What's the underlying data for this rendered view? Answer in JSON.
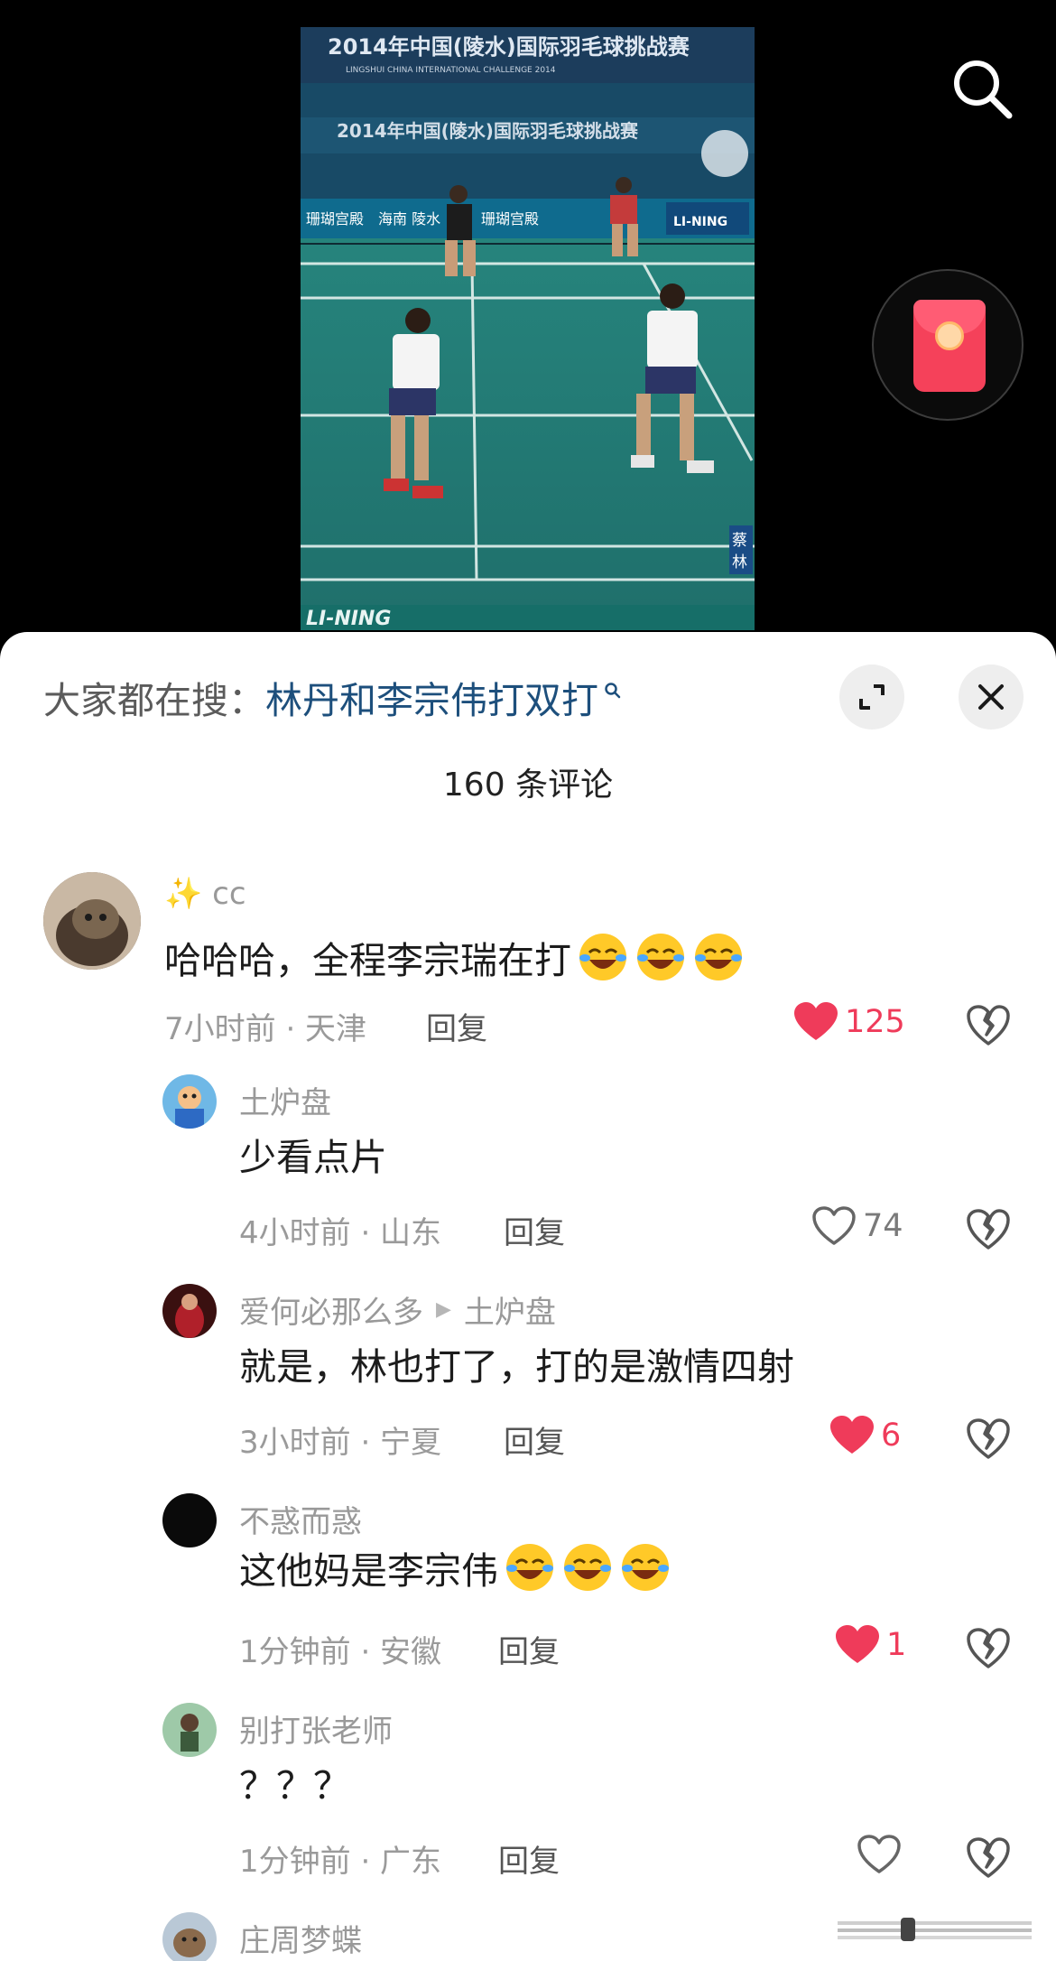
{
  "video": {
    "banner_title": "2014年中国(陵水)国际羽毛球挑战赛",
    "banner_subtitle": "LINGSHUI CHINA INTERNATIONAL CHALLENGE 2014",
    "sponsor": "LI-NING",
    "sponsor_board_1": "海南 陵水",
    "sponsor_board_2": "珊瑚宫殿",
    "scoreboard_1": "蔡",
    "scoreboard_2": "林"
  },
  "hot_search": {
    "prefix": "大家都在搜：",
    "query": "林丹和李宗伟打双打"
  },
  "comment_count": "160 条评论",
  "colors": {
    "like_red": "#ef3b5a",
    "link_blue": "#1d4f7c",
    "meta_gray": "#9a9a9a"
  },
  "comments": [
    {
      "user": "✨ cc",
      "text": "哈哈哈，全程李宗瑞在打",
      "emoji": [
        "laughing-crying-emoji",
        "laughing-crying-emoji",
        "laughing-crying-emoji"
      ],
      "meta": "7小时前 · 天津",
      "reply": "回复",
      "likes": "125",
      "liked": true
    },
    {
      "user": "土炉盘",
      "text": "少看点片",
      "meta": "4小时前 · 山东",
      "reply": "回复",
      "likes": "74",
      "liked": false
    },
    {
      "user": "爱何必那么多",
      "reply_to": "土炉盘",
      "text": "就是，林也打了，打的是激情四射",
      "meta": "3小时前 · 宁夏",
      "reply": "回复",
      "likes": "6",
      "liked": true
    },
    {
      "user": "不惑而惑",
      "text": "这他妈是李宗伟",
      "emoji": [
        "laughing-crying-emoji",
        "laughing-crying-emoji",
        "laughing-crying-emoji"
      ],
      "meta": "1分钟前 · 安徽",
      "reply": "回复",
      "likes": "1",
      "liked": true
    },
    {
      "user": "别打张老师",
      "text": "？？？",
      "meta": "1分钟前 · 广东",
      "reply": "回复",
      "likes": "",
      "liked": false
    },
    {
      "user": "庄周梦蝶"
    }
  ]
}
